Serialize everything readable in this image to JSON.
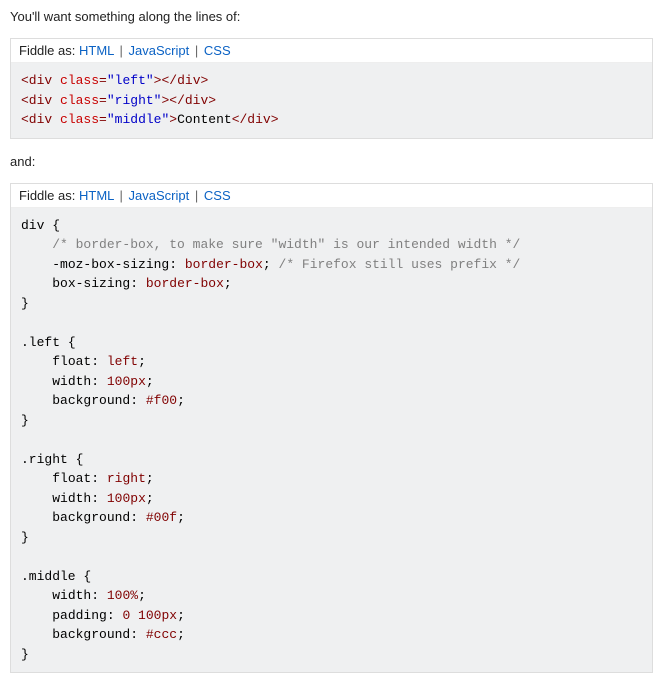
{
  "intro_text": "You'll want something along the lines of:",
  "fiddle_label": "Fiddle as:",
  "links": {
    "html": "HTML",
    "js": "JavaScript",
    "css": "CSS"
  },
  "mid_text": "and:",
  "code1": {
    "lines": [
      {
        "open": "div",
        "attr": "class",
        "val": "left",
        "text": ""
      },
      {
        "open": "div",
        "attr": "class",
        "val": "right",
        "text": ""
      },
      {
        "open": "div",
        "attr": "class",
        "val": "middle",
        "text": "Content"
      }
    ]
  },
  "code2": {
    "blocks": [
      {
        "sel": "div",
        "decls": [
          {
            "comment_before": "/* border-box, to make sure \"width\" is our intended width */"
          },
          {
            "prop": "-moz-box-sizing",
            "val": "border-box",
            "comment_after": "/* Firefox still uses prefix */"
          },
          {
            "prop": "box-sizing",
            "val": "border-box"
          }
        ]
      },
      {
        "sel": ".left",
        "decls": [
          {
            "prop": "float",
            "val": "left"
          },
          {
            "prop": "width",
            "val": "100px"
          },
          {
            "prop": "background",
            "val": "#f00"
          }
        ]
      },
      {
        "sel": ".right",
        "decls": [
          {
            "prop": "float",
            "val": "right"
          },
          {
            "prop": "width",
            "val": "100px"
          },
          {
            "prop": "background",
            "val": "#00f"
          }
        ]
      },
      {
        "sel": ".middle",
        "decls": [
          {
            "prop": "width",
            "val": "100%"
          },
          {
            "prop": "padding",
            "val": "0 100px"
          },
          {
            "prop": "background",
            "val": "#ccc"
          }
        ],
        "no_close": true
      }
    ]
  }
}
